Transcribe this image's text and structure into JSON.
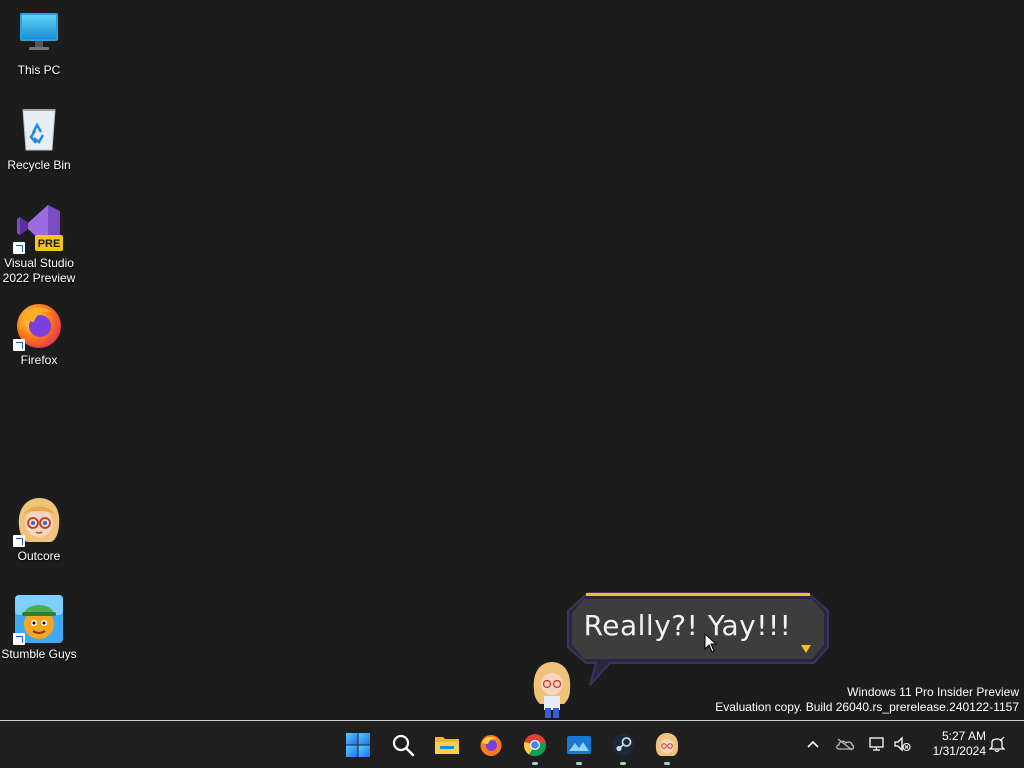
{
  "desktop": {
    "icons": [
      {
        "label": "This PC",
        "icon": "monitor-icon"
      },
      {
        "label": "Recycle Bin",
        "icon": "recycle-bin-icon"
      },
      {
        "label": "Visual Studio 2022 Preview",
        "icon": "visual-studio-icon",
        "badge": "PRE"
      },
      {
        "label": "Firefox",
        "icon": "firefox-icon"
      },
      {
        "label": "Outcore",
        "icon": "outcore-icon"
      },
      {
        "label": "Stumble Guys",
        "icon": "stumble-guys-icon"
      }
    ]
  },
  "bubble": {
    "text": "Really?! Yay!!!",
    "color": "#3d3d3d",
    "accent": "#f0c020"
  },
  "watermark": {
    "line1": "Windows 11 Pro Insider Preview",
    "line2": "Evaluation copy. Build 26040.rs_prerelease.240122-1157"
  },
  "taskbar": {
    "apps": [
      {
        "name": "start",
        "icon": "windows-logo-icon",
        "running": false
      },
      {
        "name": "search",
        "icon": "search-icon",
        "running": false
      },
      {
        "name": "file-explorer",
        "icon": "folder-icon",
        "running": false
      },
      {
        "name": "firefox",
        "icon": "firefox-icon",
        "running": false
      },
      {
        "name": "chrome",
        "icon": "chrome-icon",
        "running": true
      },
      {
        "name": "photos",
        "icon": "photos-icon",
        "running": true
      },
      {
        "name": "steam",
        "icon": "steam-icon",
        "running": true
      },
      {
        "name": "outcore",
        "icon": "outcore-icon",
        "running": true
      }
    ],
    "tray": {
      "icons": [
        "chevron-up-icon",
        "onedrive-icon",
        "network-icon",
        "volume-muted-icon"
      ],
      "time": "5:27 AM",
      "date": "1/31/2024",
      "notification_icon": "notification-bell-icon"
    }
  }
}
